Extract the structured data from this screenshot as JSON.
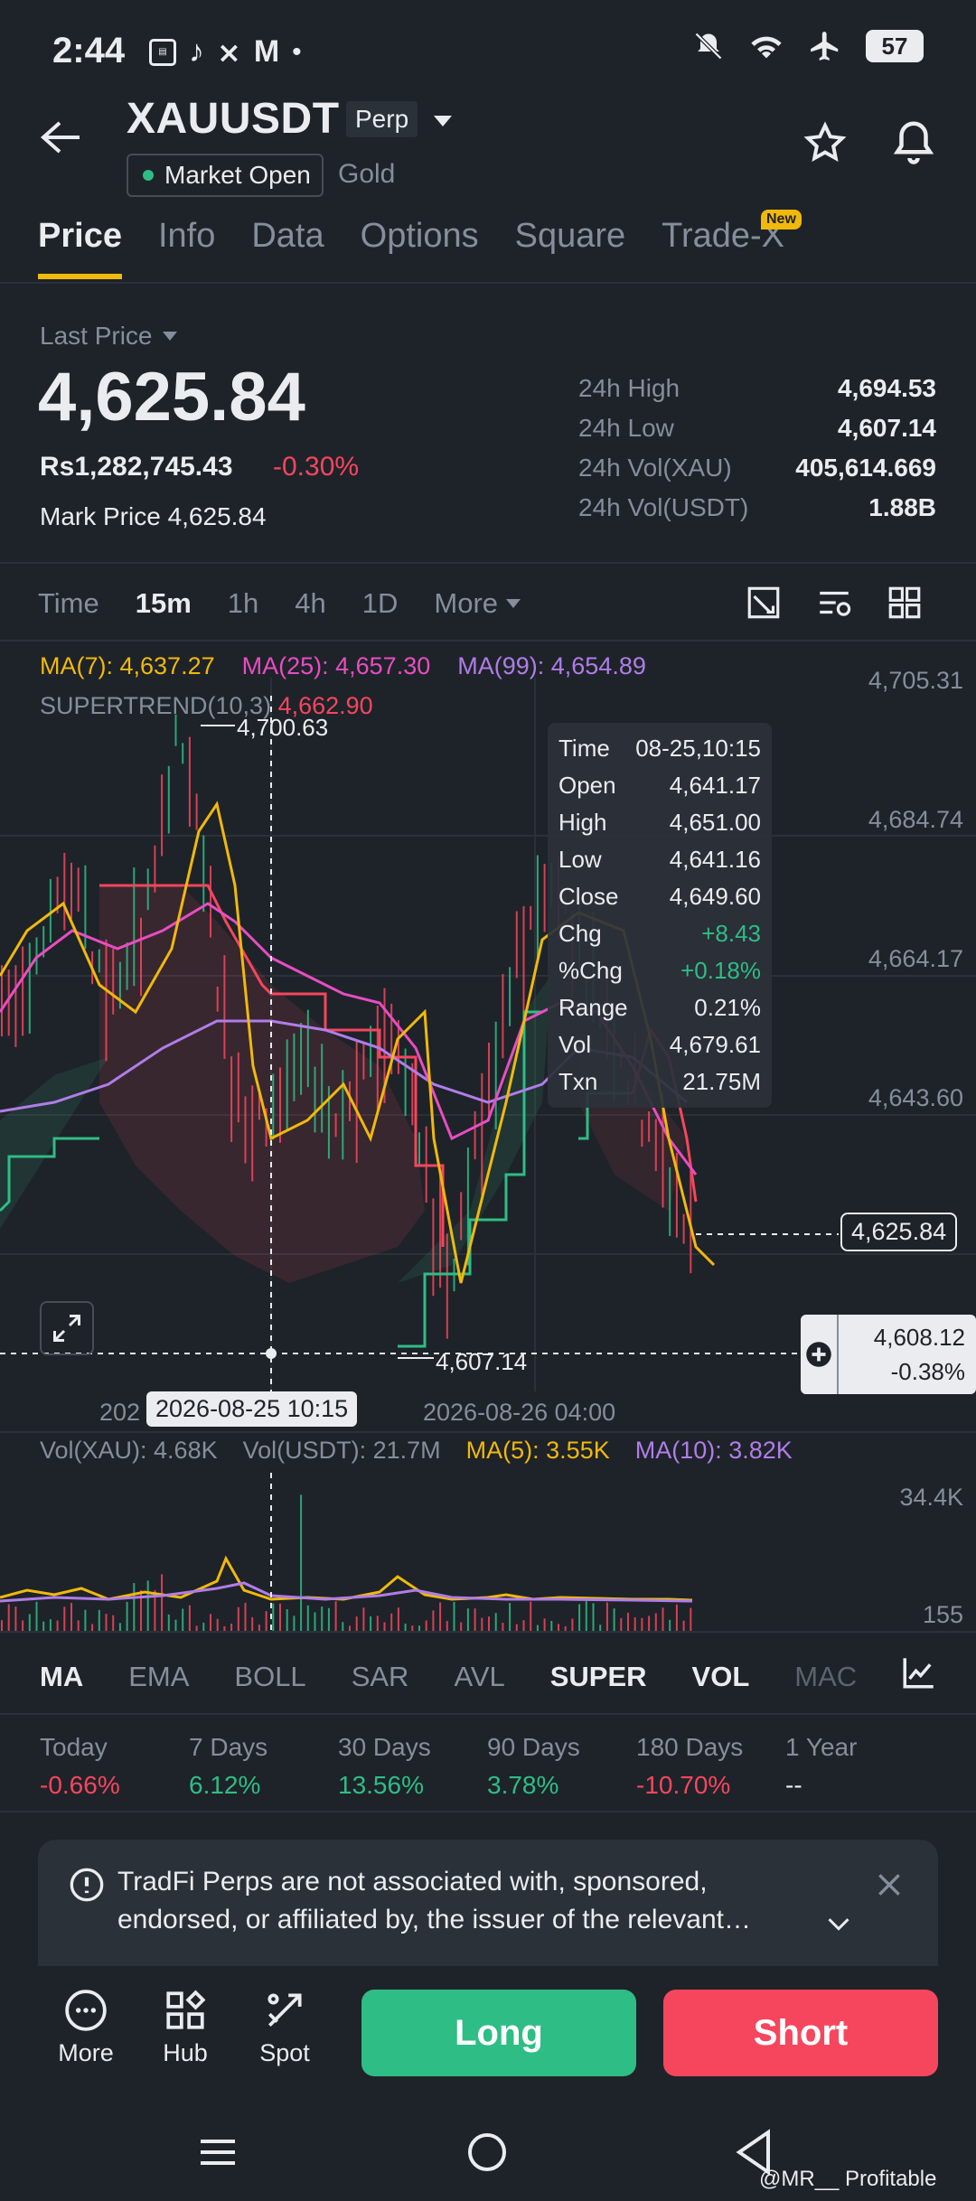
{
  "status_bar": {
    "time": "2:44",
    "app_icons": [
      "app-badge-icon",
      "tiktok-icon",
      "app-x-icon",
      "gmail-icon",
      "dot-icon"
    ],
    "battery": "57"
  },
  "header": {
    "symbol": "XAUUSDT",
    "contract_type": "Perp",
    "market_status": "Market Open",
    "category": "Gold"
  },
  "tabs": [
    "Price",
    "Info",
    "Data",
    "Options",
    "Square",
    "Trade-X"
  ],
  "new_badge": "New",
  "price": {
    "last_price_label": "Last Price",
    "last_price": "4,625.84",
    "fiat_price": "Rs1,282,745.43",
    "change_pct": "-0.30%",
    "mark_price_label": "Mark Price",
    "mark_price": "4,625.84"
  },
  "stats": [
    {
      "label": "24h High",
      "value": "4,694.53"
    },
    {
      "label": "24h Low",
      "value": "4,607.14"
    },
    {
      "label": "24h Vol(XAU)",
      "value": "405,614.669"
    },
    {
      "label": "24h Vol(USDT)",
      "value": "1.88B"
    }
  ],
  "timeframes": [
    "Time",
    "15m",
    "1h",
    "4h",
    "1D",
    "More"
  ],
  "chart": {
    "ma7": "MA(7): 4,637.27",
    "ma25": "MA(25): 4,657.30",
    "ma99": "MA(99): 4,654.89",
    "supertrend_label": "SUPERTREND(10,3)",
    "supertrend_value": "4,662.90",
    "y_ticks": [
      "4,705.31",
      "4,684.74",
      "4,664.17",
      "4,643.60"
    ],
    "high_label": "4,700.63",
    "low_label": "4,607.14",
    "last_price_tag": "4,625.84",
    "crosshair_price": "4,608.12",
    "crosshair_pct": "-0.38%",
    "x_label_left": "202",
    "x_label_active": "2026-08-25 10:15",
    "x_label_right": "2026-08-26 04:00",
    "colors": {
      "ma7": "#f0b90b",
      "ma25": "#e84dc2",
      "ma99": "#b07de8",
      "supertrend_up": "#2ebd85",
      "supertrend_down": "#f6465d"
    }
  },
  "tooltip": [
    {
      "k": "Time",
      "v": "08-25,10:15"
    },
    {
      "k": "Open",
      "v": "4,641.17"
    },
    {
      "k": "High",
      "v": "4,651.00"
    },
    {
      "k": "Low",
      "v": "4,641.16"
    },
    {
      "k": "Close",
      "v": "4,649.60"
    },
    {
      "k": "Chg",
      "v": "+8.43"
    },
    {
      "k": "%Chg",
      "v": "+0.18%"
    },
    {
      "k": "Range",
      "v": "0.21%"
    },
    {
      "k": "Vol",
      "v": "4,679.61"
    },
    {
      "k": "Txn",
      "v": "21.75M"
    }
  ],
  "volume": {
    "vol_xau": "Vol(XAU): 4.68K",
    "vol_usdt": "Vol(USDT): 21.7M",
    "ma5": "MA(5): 3.55K",
    "ma10": "MA(10): 3.82K",
    "top_tick": "34.4K",
    "bottom_tick": "155"
  },
  "indicators": [
    "MA",
    "EMA",
    "BOLL",
    "SAR",
    "AVL",
    "SUPER",
    "VOL",
    "MAC"
  ],
  "performance": [
    {
      "label": "Today",
      "value": "-0.66%"
    },
    {
      "label": "7 Days",
      "value": "6.12%"
    },
    {
      "label": "30 Days",
      "value": "13.56%"
    },
    {
      "label": "90 Days",
      "value": "3.78%"
    },
    {
      "label": "180 Days",
      "value": "-10.70%"
    },
    {
      "label": "1 Year",
      "value": "--"
    }
  ],
  "disclaimer": {
    "line1": "TradFi Perps are not associated with, sponsored,",
    "line2": "endorsed, or affiliated by, the issuer of the relevant…"
  },
  "actions": {
    "more": "More",
    "hub": "Hub",
    "spot": "Spot",
    "long": "Long",
    "short": "Short"
  },
  "watermark": "@MR__ Profitable"
}
